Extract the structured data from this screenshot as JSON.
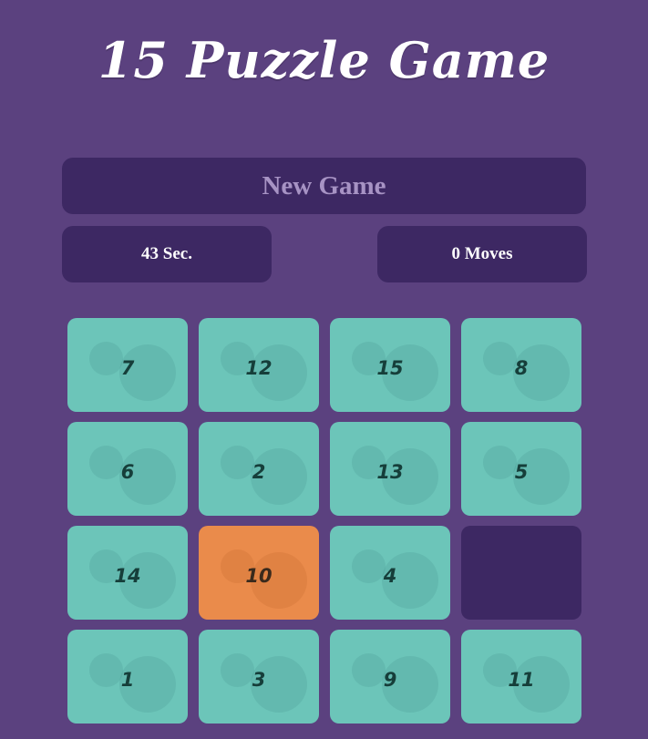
{
  "header": {
    "title": "15 Puzzle Game"
  },
  "controls": {
    "new_game_label": "New Game",
    "timer_text": "43 Sec.",
    "moves_text": "0 Moves"
  },
  "board": {
    "rows": 4,
    "cols": 4,
    "tiles": [
      [
        "7",
        "12",
        "15",
        "8"
      ],
      [
        "6",
        "2",
        "13",
        "5"
      ],
      [
        "14",
        "10",
        "4",
        ""
      ],
      [
        "1",
        "3",
        "9",
        "11"
      ]
    ],
    "highlighted_tile": "10"
  },
  "colors": {
    "background": "#5b417f",
    "panel": "#3d2863",
    "tile": "#6cc5b9",
    "tile_highlight": "#ea8b4b",
    "tile_text": "#163e3a",
    "new_game_text": "#a793c4"
  }
}
